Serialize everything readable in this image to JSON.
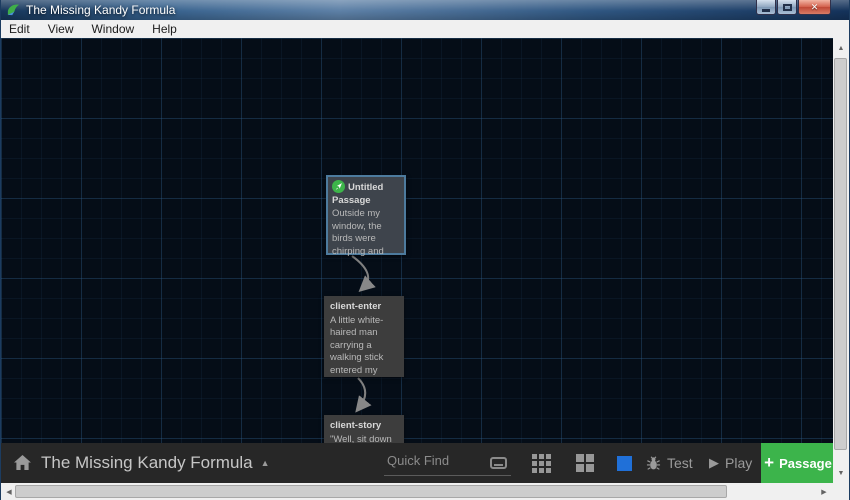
{
  "window": {
    "title": "The Missing Kandy Formula"
  },
  "menu": {
    "items": [
      "Edit",
      "View",
      "Window",
      "Help"
    ]
  },
  "icons": {
    "close": "✕",
    "caret_up": "▲",
    "play": "▶",
    "plus": "+",
    "scroll_up": "▲",
    "scroll_down": "▼",
    "scroll_left": "◀",
    "scroll_right": "▶"
  },
  "passages": [
    {
      "title": "Untitled Passage",
      "excerpt": "Outside my window, the birds were chirping and",
      "selected": true,
      "is_start": true
    },
    {
      "title": "client-enter",
      "excerpt": "A little white-haired man carrying a walking stick entered my",
      "selected": false,
      "is_start": false
    },
    {
      "title": "client-story",
      "excerpt": "\"Well, sit down",
      "selected": false,
      "is_start": false
    }
  ],
  "toolbar": {
    "story_title": "The Missing Kandy Formula",
    "quick_find": {
      "placeholder": "Quick Find",
      "value": ""
    },
    "test_label": "Test",
    "play_label": "Play",
    "passage_label": "Passage"
  },
  "colors": {
    "passage_button_green": "#3cb44b",
    "zoom_active_blue": "#2070d8",
    "selected_passage_border": "#4d7b9e",
    "start_icon_green": "#3db54a"
  }
}
